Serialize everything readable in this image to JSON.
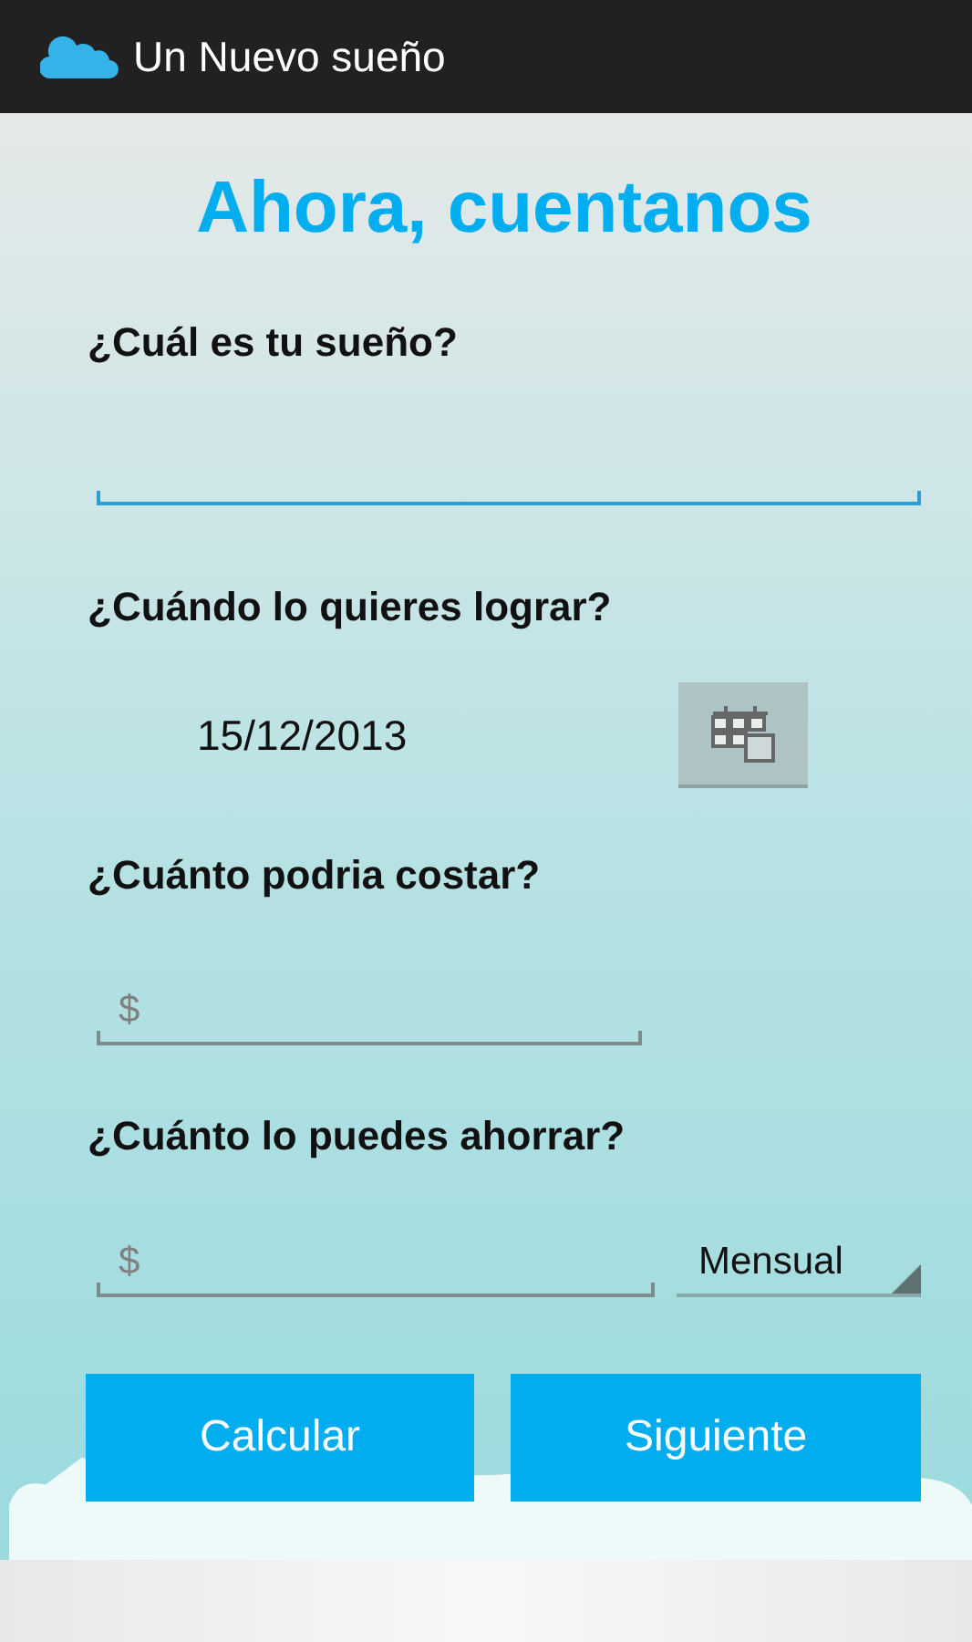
{
  "app_bar": {
    "title": "Un Nuevo sueño"
  },
  "heading": "Ahora, cuentanos",
  "fields": [
    {
      "kind": "text",
      "label": "¿Cuál es tu sueño?",
      "focused": true
    },
    {
      "kind": "date",
      "label": "¿Cuándo lo quieres lograr?",
      "value": "15/12/2013"
    },
    {
      "kind": "money",
      "label": "¿Cuánto podria costar?",
      "placeholder": "$",
      "focused": false
    },
    {
      "kind": "money_period",
      "label": "¿Cuánto lo puedes ahorrar?",
      "placeholder": "$",
      "focused": false,
      "period": "Mensual"
    }
  ],
  "buttons": [
    "Calcular",
    "Siguiente"
  ]
}
